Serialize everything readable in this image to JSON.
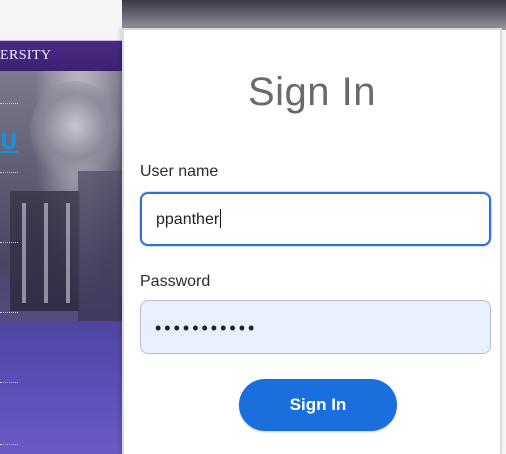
{
  "background": {
    "banner_text": "ERSITY",
    "link_text": "U"
  },
  "signin": {
    "title": "Sign In",
    "username_label": "User name",
    "username_value": "ppanther",
    "password_label": "Password",
    "password_masked": "•••••••••••",
    "submit_label": "Sign In"
  },
  "colors": {
    "accent": "#1a6fdc",
    "banner": "#4a2a84",
    "focus_border": "#2f6fd6",
    "autofill_bg": "#e8f0fd"
  }
}
